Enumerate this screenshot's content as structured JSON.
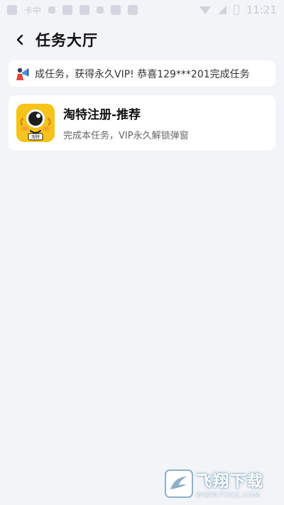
{
  "status_bar": {
    "left_text": "卡中",
    "time": "11:21"
  },
  "header": {
    "title": "任务大厅"
  },
  "notice": {
    "text": "成任务，获得永久VIP!  恭喜129***201完成任务"
  },
  "tasks": [
    {
      "title": "淘特注册-推荐",
      "description": "完成本任务，VIP永久解锁弹窗",
      "icon_badge": "淘特"
    }
  ],
  "watermark": {
    "name": "飞翔下载",
    "url": "WWW.FXXZ.COM"
  },
  "colors": {
    "background": "#f3f4f8",
    "card": "#ffffff",
    "icon_yellow": "#f5c319"
  }
}
